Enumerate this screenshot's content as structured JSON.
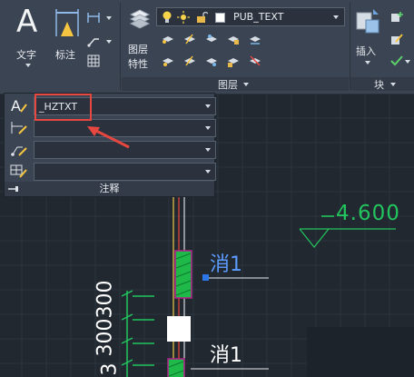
{
  "ribbon": {
    "annotate_group": {
      "text_label": "文字",
      "dimension_label": "标注"
    },
    "layer_group": {
      "properties_label_line1": "图层",
      "properties_label_line2": "特性",
      "current_layer": "PUB_TEXT",
      "panel_title": "图层"
    },
    "block_group": {
      "insert_label": "插入",
      "panel_title": "块"
    }
  },
  "annotation_panel": {
    "text_style": "_HZTXT",
    "dim_style": "",
    "leader_style": "",
    "table_style": "",
    "title": "注释"
  },
  "drawing": {
    "elevation_text": "4.600",
    "label_upper": "消1",
    "label_lower": "消1",
    "dimension_text": "300300",
    "dimension_partial": "3"
  },
  "colors": {
    "ribbon_bg": "#3b4453",
    "canvas_bg": "#212830",
    "highlight_red": "#e8473f",
    "cad_green": "#22c55e",
    "cad_white": "#ffffff"
  }
}
